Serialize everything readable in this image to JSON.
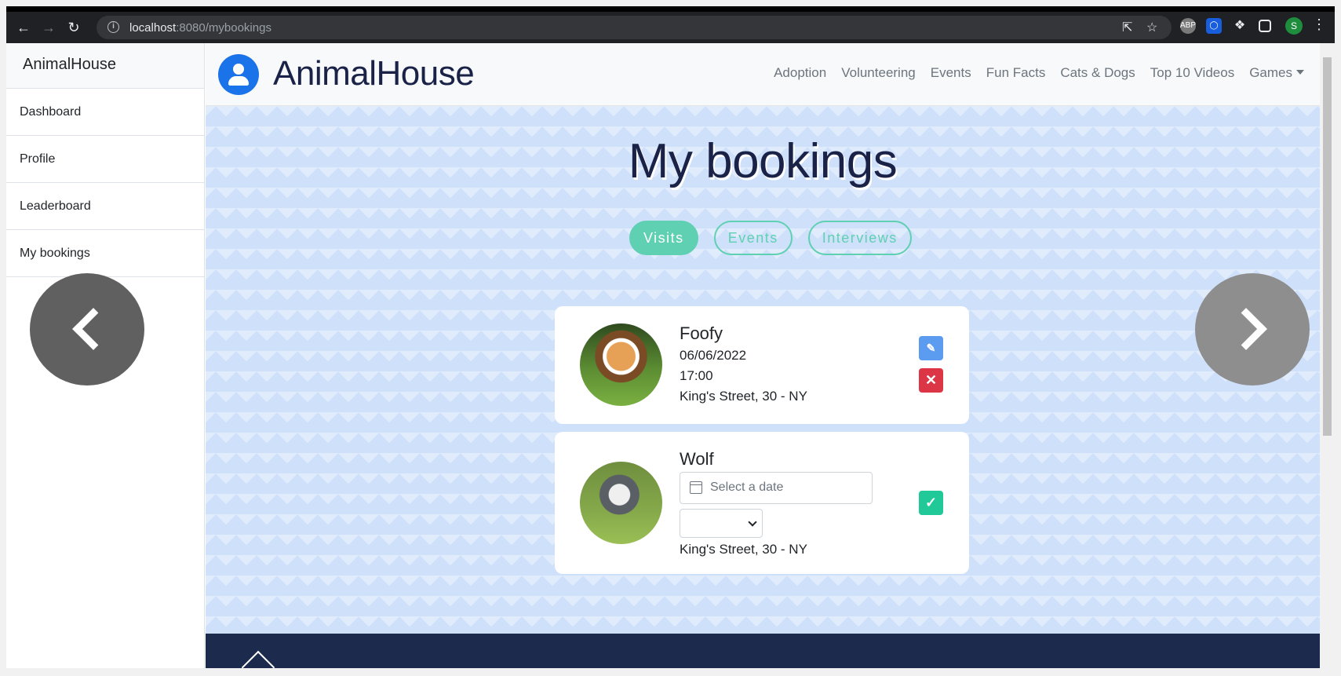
{
  "browser": {
    "url_host": "localhost",
    "url_path": ":8080/mybookings",
    "profile_initial": "S",
    "extensions": [
      "abp-icon",
      "bitwarden-icon",
      "puzzle-icon",
      "side-panel-icon"
    ]
  },
  "sidebar": {
    "title": "AnimalHouse",
    "items": [
      {
        "label": "Dashboard"
      },
      {
        "label": "Profile"
      },
      {
        "label": "Leaderboard"
      },
      {
        "label": "My bookings"
      }
    ]
  },
  "navbar": {
    "brand": "AnimalHouse",
    "links": [
      "Adoption",
      "Volunteering",
      "Events",
      "Fun Facts",
      "Cats & Dogs",
      "Top 10 Videos",
      "Games"
    ]
  },
  "page": {
    "title": "My bookings",
    "tabs": [
      {
        "label": "Visits",
        "active": true
      },
      {
        "label": "Events",
        "active": false
      },
      {
        "label": "Interviews",
        "active": false
      }
    ]
  },
  "bookings": [
    {
      "name": "Foofy",
      "date": "06/06/2022",
      "time": "17:00",
      "address": "King's Street, 30 - NY"
    },
    {
      "name": "Wolf",
      "date_placeholder": "Select a date",
      "time_value": "",
      "address": "King's Street, 30 - NY"
    }
  ],
  "colors": {
    "accent": "#5fd0b1",
    "primary": "#1a73e8",
    "danger": "#dc3545",
    "success": "#20c997",
    "navy": "#1c2a4d"
  }
}
